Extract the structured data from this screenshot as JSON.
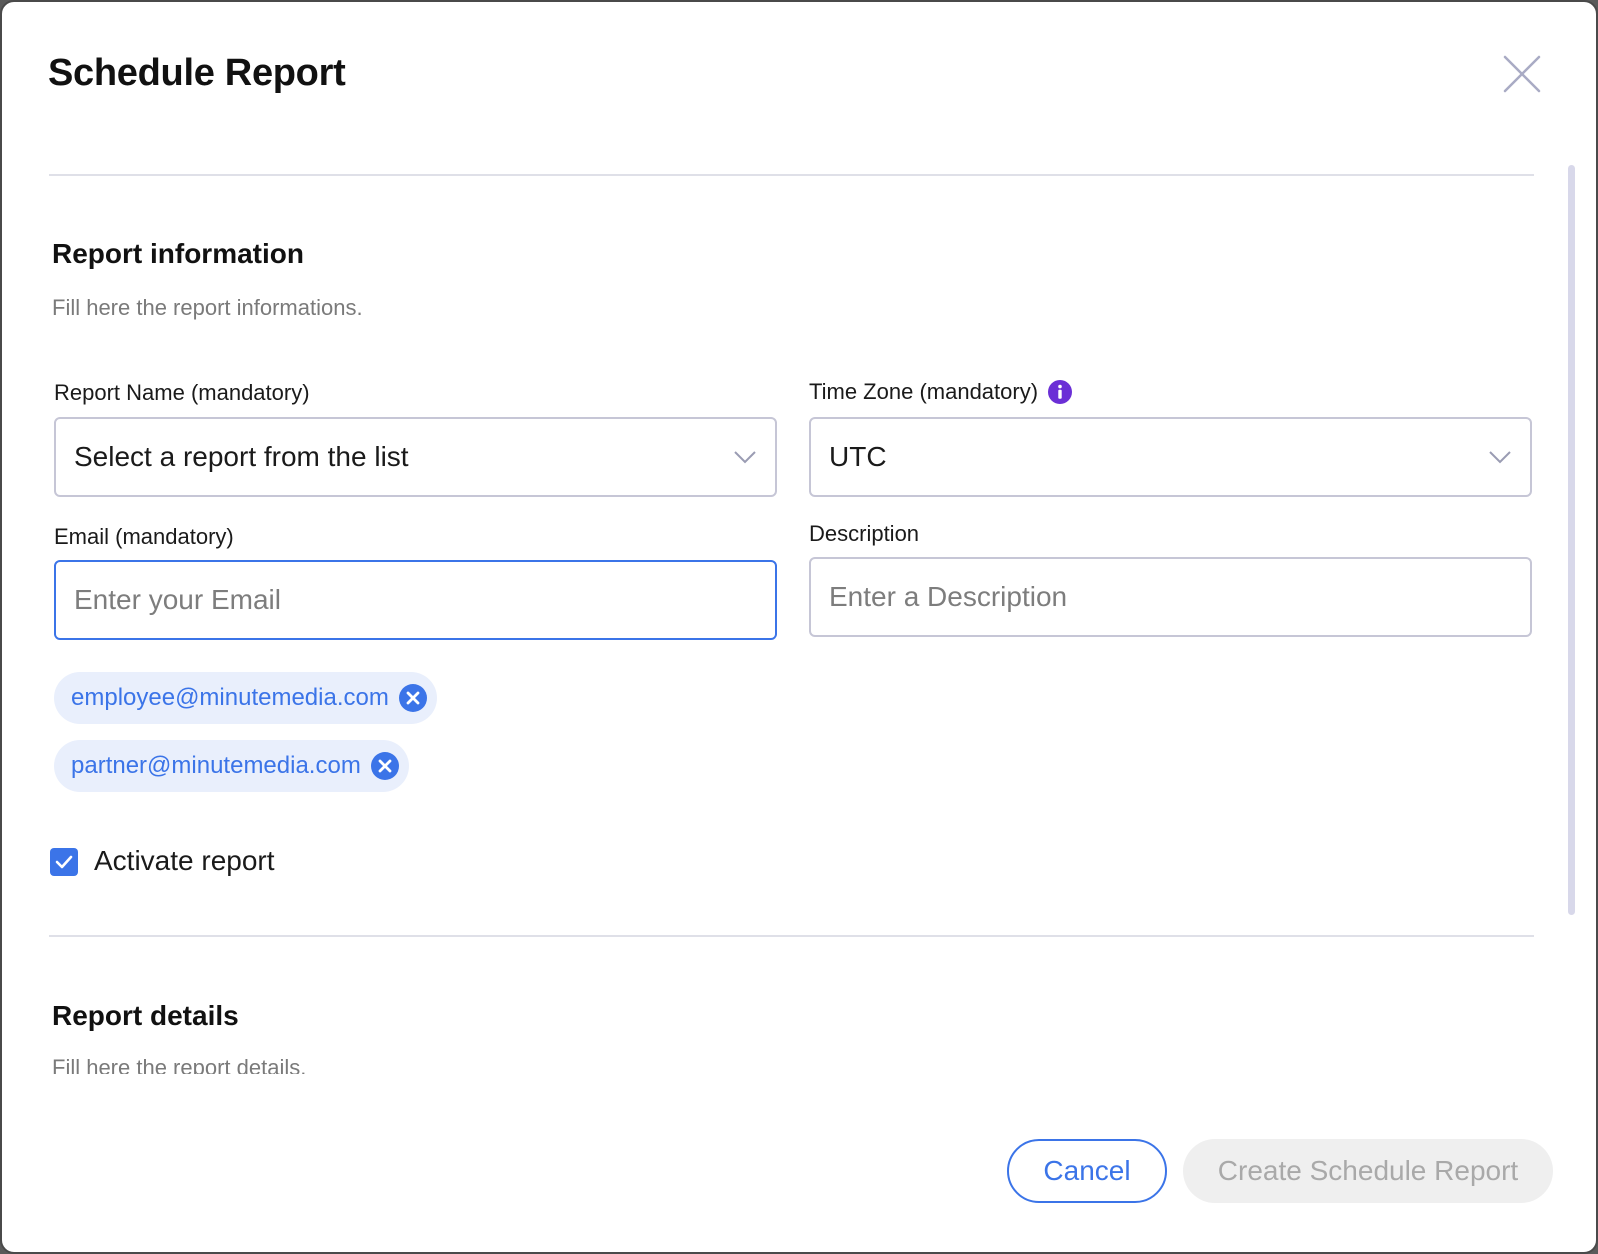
{
  "dialog": {
    "title": "Schedule Report"
  },
  "report_information": {
    "title": "Report information",
    "subtitle": "Fill here the report informations."
  },
  "fields": {
    "report_name": {
      "label": "Report Name (mandatory)",
      "value": "Select a report from the list"
    },
    "time_zone": {
      "label": "Time Zone (mandatory)",
      "value": "UTC"
    },
    "email": {
      "label": "Email (mandatory)",
      "placeholder": "Enter your Email",
      "value": ""
    },
    "description": {
      "label": "Description",
      "placeholder": "Enter a Description",
      "value": ""
    }
  },
  "emails": [
    "employee@minutemedia.com",
    "partner@minutemedia.com"
  ],
  "activate": {
    "label": "Activate report",
    "checked": true
  },
  "report_details": {
    "title": "Report details",
    "subtitle": "Fill here the report details."
  },
  "footer": {
    "cancel_label": "Cancel",
    "create_label": "Create Schedule Report"
  },
  "colors": {
    "accent": "#3b74e8",
    "info_icon": "#6b2fd6",
    "chip_bg": "#e9effc",
    "disabled_bg": "#efefef",
    "disabled_text": "#a9a9a9"
  },
  "icons": {
    "close": "close-icon",
    "chevron": "chevron-down-icon",
    "info": "info-icon",
    "remove": "remove-circle-icon",
    "check": "checkmark-icon"
  }
}
